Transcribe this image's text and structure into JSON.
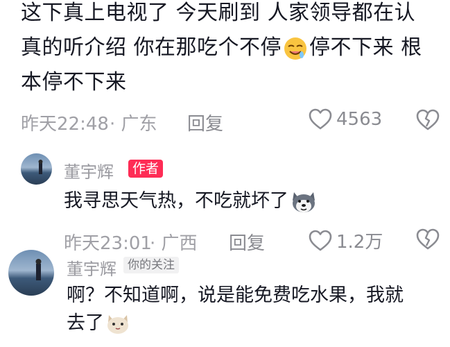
{
  "top_comment": {
    "lines": [
      "这下真上电视了 今天刷到 人家领导都在认",
      "真的听介绍 你在那吃个不停",
      "停不下来 根",
      "本停不下来"
    ],
    "time": "昨天22:48",
    "location": "· 广东",
    "reply_label": "回复",
    "likes": "4563"
  },
  "reply1": {
    "username": "董宇辉",
    "tag": "作者",
    "text": "我寻思天气热，不吃就坏了",
    "time": "昨天23:01",
    "location": "· 广西",
    "reply_label": "回复",
    "likes": "1.2万"
  },
  "reply2": {
    "username": "董宇辉",
    "tag": "你的关注",
    "line1": "啊？不知道啊，说是能免费吃水果，我就",
    "line2": "去了"
  },
  "colors": {
    "accent": "#fe2c55",
    "muted": "#a0a0a6"
  },
  "icons": [
    "drooling-emoji",
    "heart-outline-icon",
    "broken-heart-icon",
    "husky-emoji",
    "cat-emoji"
  ]
}
